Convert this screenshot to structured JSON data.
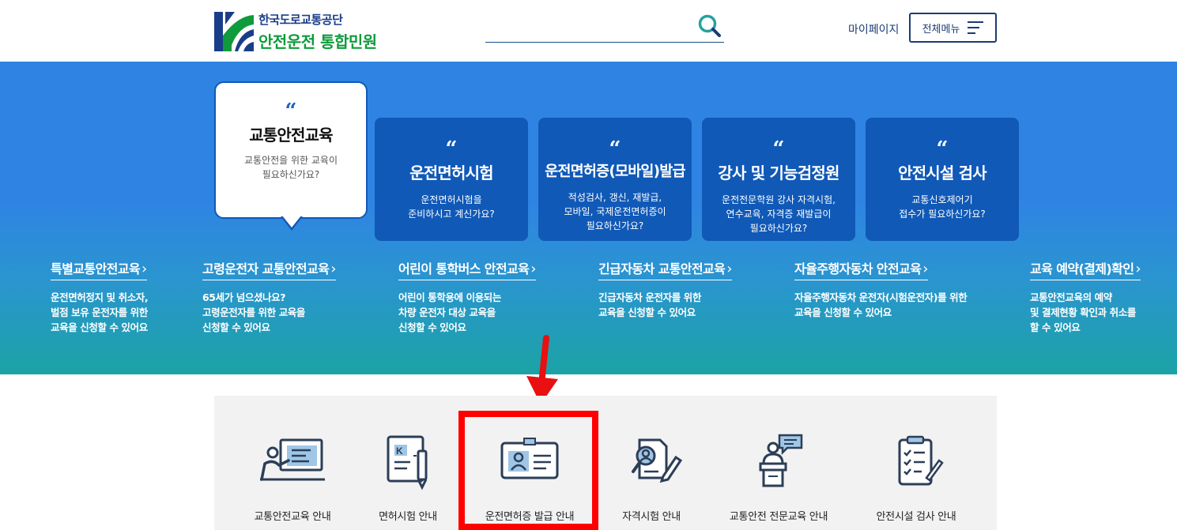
{
  "header": {
    "org_name": "한국도로교통공단",
    "site_name": "안전운전 통합민원",
    "mypage_label": "마이페이지",
    "menu_label": "전체메뉴"
  },
  "featured": {
    "title": "교통안전교육",
    "desc1": "교통안전을 위한 교육이",
    "desc2": "필요하신가요?",
    "quote": "“"
  },
  "cards": [
    {
      "title": "운전면허시험",
      "desc": [
        "운전면허시험을",
        "준비하시고 계신가요?"
      ]
    },
    {
      "title": "운전면허증(모바일)발급",
      "desc": [
        "적성검사, 갱신, 재발급,",
        "모바일, 국제운전면허증이",
        "필요하신가요?"
      ]
    },
    {
      "title": "강사 및 기능검정원",
      "desc": [
        "운전전문학원 강사 자격시험,",
        "연수교육, 자격증 재발급이",
        "필요하신가요?"
      ]
    },
    {
      "title": "안전시설 검사",
      "desc": [
        "교통신호제어기",
        "접수가 필요하신가요?"
      ]
    }
  ],
  "links": [
    {
      "title": "특별교통안전교육",
      "desc": [
        "운전면허정지 및 취소자,",
        "벌점 보유 운전자를 위한",
        "교육을 신청할 수 있어요"
      ]
    },
    {
      "title": "고령운전자 교통안전교육",
      "desc": [
        "65세가 넘으셨나요?",
        "고령운전자를 위한 교육을",
        "신청할 수 있어요"
      ]
    },
    {
      "title": "어린이 통학버스 안전교육",
      "desc": [
        "어린이 통학용에 이용되는",
        "차량 운전자 대상 교육을",
        "신청할 수 있어요"
      ]
    },
    {
      "title": "긴급자동차 교통안전교육",
      "desc": [
        "긴급자동차 운전자를 위한",
        "교육을 신청할 수 있어요"
      ]
    },
    {
      "title": "자율주행자동차 안전교육",
      "desc": [
        "자율주행자동차 운전자(시험운전자)를 위한",
        "교육을 신청할 수 있어요"
      ]
    },
    {
      "title": "교육 예약(결제)확인",
      "desc": [
        "교통안전교육의 예약",
        "및 결제현황 확인과 취소를",
        "할 수 있어요"
      ]
    }
  ],
  "services": [
    {
      "label": "교통안전교육 안내",
      "icon": "presentation-icon"
    },
    {
      "label": "면허시험 안내",
      "icon": "license-exam-icon"
    },
    {
      "label": "운전면허증 발급 안내",
      "icon": "id-card-icon"
    },
    {
      "label": "자격시험 안내",
      "icon": "certificate-icon"
    },
    {
      "label": "교통안전 전문교육 안내",
      "icon": "lecturer-icon"
    },
    {
      "label": "안전시설 검사 안내",
      "icon": "checklist-icon"
    }
  ],
  "colors": {
    "brand_blue": "#1b3b73",
    "brand_green": "#0f9b3c",
    "card_blue": "#1059b7",
    "highlight": "#ff0000"
  }
}
